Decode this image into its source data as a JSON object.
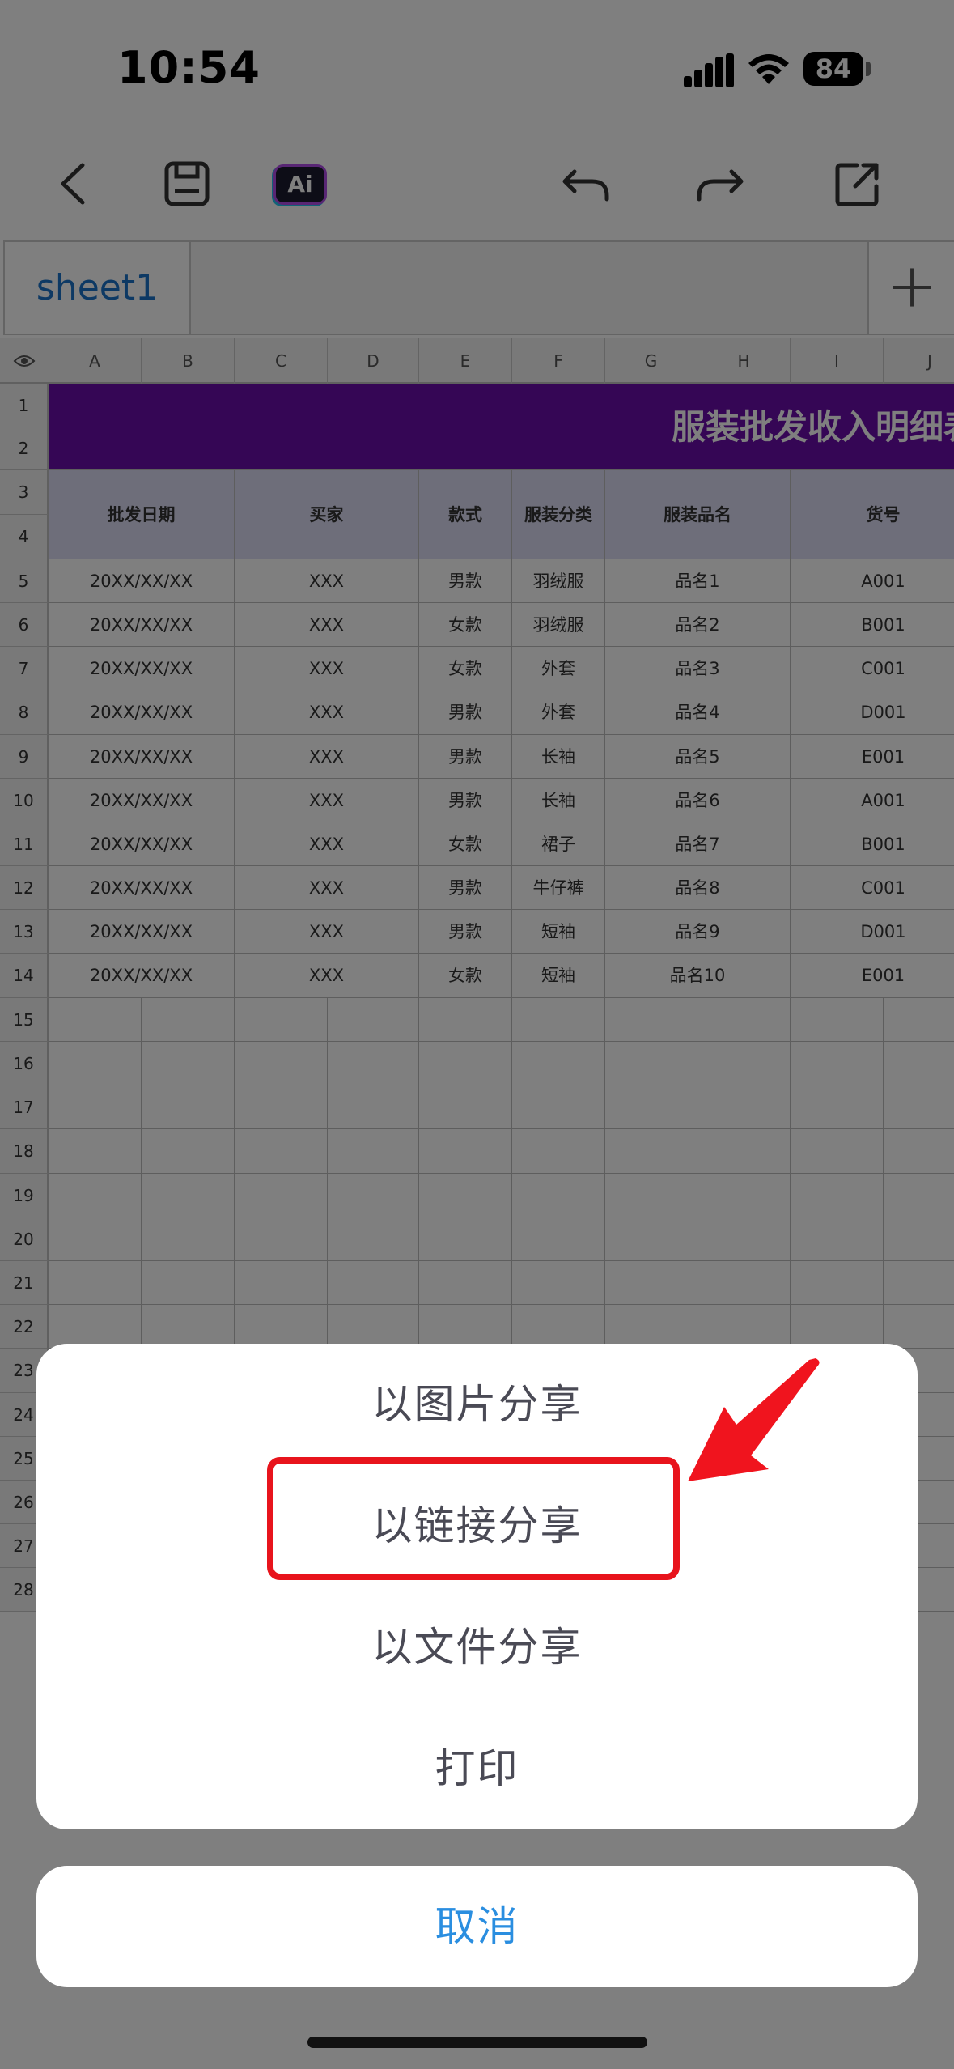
{
  "status_bar": {
    "time": "10:54",
    "battery": "84"
  },
  "toolbar": {
    "back": "back-icon",
    "save": "save-icon",
    "ai_label": "Ai",
    "undo": "undo-icon",
    "redo": "redo-icon",
    "share": "share-icon"
  },
  "sheets": {
    "active_tab": "sheet1",
    "add_icon": "plus-icon"
  },
  "spreadsheet": {
    "columns": [
      "A",
      "B",
      "C",
      "D",
      "E",
      "F",
      "G",
      "H",
      "I",
      "J"
    ],
    "row_numbers": [
      "1",
      "2",
      "3",
      "4",
      "5",
      "6",
      "7",
      "8",
      "9",
      "10",
      "11",
      "12",
      "13",
      "14",
      "15",
      "16",
      "17",
      "18",
      "19",
      "20",
      "21",
      "22",
      "23",
      "24",
      "25",
      "26",
      "27",
      "28"
    ],
    "title": "服装批发收入明细表",
    "title_color": "#6a0dab",
    "headers": [
      "批发日期",
      "买家",
      "款式",
      "服装分类",
      "服装品名",
      "货号"
    ],
    "rows": [
      [
        "20XX/XX/XX",
        "XXX",
        "男款",
        "羽绒服",
        "品名1",
        "A001"
      ],
      [
        "20XX/XX/XX",
        "XXX",
        "女款",
        "羽绒服",
        "品名2",
        "B001"
      ],
      [
        "20XX/XX/XX",
        "XXX",
        "女款",
        "外套",
        "品名3",
        "C001"
      ],
      [
        "20XX/XX/XX",
        "XXX",
        "男款",
        "外套",
        "品名4",
        "D001"
      ],
      [
        "20XX/XX/XX",
        "XXX",
        "男款",
        "长袖",
        "品名5",
        "E001"
      ],
      [
        "20XX/XX/XX",
        "XXX",
        "男款",
        "长袖",
        "品名6",
        "A001"
      ],
      [
        "20XX/XX/XX",
        "XXX",
        "女款",
        "裙子",
        "品名7",
        "B001"
      ],
      [
        "20XX/XX/XX",
        "XXX",
        "男款",
        "牛仔裤",
        "品名8",
        "C001"
      ],
      [
        "20XX/XX/XX",
        "XXX",
        "男款",
        "短袖",
        "品名9",
        "D001"
      ],
      [
        "20XX/XX/XX",
        "XXX",
        "女款",
        "短袖",
        "品名10",
        "E001"
      ]
    ]
  },
  "share_sheet": {
    "options": [
      "以图片分享",
      "以链接分享",
      "以文件分享",
      "打印"
    ],
    "highlighted": "以链接分享",
    "cancel": "取消",
    "highlight_color": "#e8141c"
  }
}
